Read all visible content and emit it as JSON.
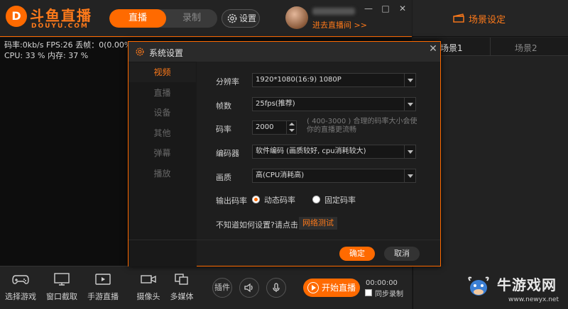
{
  "brand": {
    "mark": "D",
    "title": "斗鱼直播",
    "subtitle": "DOUYU.COM"
  },
  "top": {
    "tab_live": "直播",
    "tab_record": "录制",
    "settings_label": "设置",
    "enter_room": "进去直播间 >>"
  },
  "window_controls": {
    "min": "—",
    "max": "□",
    "close": "✕"
  },
  "stats": {
    "line1": "码率:0kb/s   FPS:26  丢帧：0(0.00%)",
    "line2": "CPU: 33 %    内存: 37 %"
  },
  "scenes": {
    "title": "场景设定",
    "tabs": [
      "场景1",
      "场景2"
    ]
  },
  "dialog": {
    "title": "系统设置",
    "close": "✕",
    "nav": [
      "视频",
      "直播",
      "设备",
      "其他",
      "弹幕",
      "播放"
    ],
    "fields": {
      "resolution_label": "分辨率",
      "resolution_value": "1920*1080(16:9) 1080P",
      "fps_label": "帧数",
      "fps_value": "25fps(推荐)",
      "bitrate_label": "码率",
      "bitrate_value": "2000",
      "bitrate_hint": "( 400-3000 ) 合理的码率大小会使你的直播更流畅",
      "encoder_label": "编码器",
      "encoder_value": "软件编码 (画质较好, cpu消耗较大)",
      "quality_label": "画质",
      "quality_value": "高(CPU消耗高)",
      "output_label": "输出码率",
      "radio_dynamic": "动态码率",
      "radio_fixed": "固定码率",
      "help_text": "不知道如何设置?请点击",
      "net_test": "网络测试"
    },
    "ok": "确定",
    "cancel": "取消"
  },
  "bottom": {
    "tools": [
      "选择游戏",
      "窗口截取",
      "手游直播",
      "摄像头",
      "多媒体"
    ],
    "plugin": "插件",
    "start_live": "开始直播",
    "timer": "00:00:00",
    "sync_record": "同步录制"
  },
  "watermark": {
    "text": "牛游戏网",
    "url": "www.newyx.net"
  },
  "colors": {
    "accent": "#ff6a00",
    "bg": "#1c1c1c"
  }
}
